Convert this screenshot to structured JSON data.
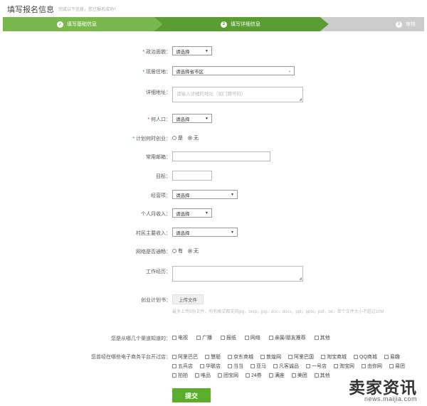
{
  "header": {
    "title": "填写报名信息",
    "subtitle": "完成以下信息，您已报名成功！"
  },
  "steps": [
    {
      "num": "✓",
      "label": "填写基础信息"
    },
    {
      "num": "2",
      "label": "填写详细信息"
    },
    {
      "num": "3",
      "label": "审核"
    }
  ],
  "colors": {
    "step_done": "#7ab84d",
    "step_active": "#5a9e33",
    "step_pending": "#cccccc",
    "submit": "#5dad2c"
  },
  "form": {
    "political": {
      "label": "政治面貌：",
      "value": "请选择"
    },
    "residence": {
      "label": "现居住地：",
      "value": "请选择省市区"
    },
    "address": {
      "label": "详细地址：",
      "placeholder": "请输入详细的地址（如门牌号码）"
    },
    "household": {
      "label": "何人口：",
      "value": "请选择"
    },
    "plan": {
      "label": "计划何时创业：",
      "opt1": "是",
      "opt2": "无"
    },
    "email": {
      "label": "常用邮箱："
    },
    "age": {
      "label": "目标："
    },
    "education": {
      "label": "经营项：",
      "value": "请选择"
    },
    "income": {
      "label": "个人月收入：",
      "value": "请选择"
    },
    "village_income": {
      "label": "村民主要收入：",
      "value": "请选择"
    },
    "online_shop": {
      "label": "网络是否通畅：",
      "opt1": "有",
      "opt2": "无"
    },
    "experience": {
      "label": "工作经历："
    },
    "plan_doc": {
      "label": "创业计划书：",
      "button": "上传文件",
      "hint": "最多上传5份文件，所有格式都支持jpg，bmp，jpg，doc，docx，ppt，pptx，pdf，txt，单个文件大小不超过10M"
    },
    "source": {
      "label": "您是从哪几个渠道知道的：",
      "options": [
        "电视",
        "广播",
        "报纸",
        "网络",
        "亲属/朋友推荐",
        "其他"
      ]
    },
    "platforms": {
      "label": "您曾经在哪些电子商务平台开过店：",
      "rows": [
        [
          "阿里巴巴",
          "慧聪",
          "京东商城",
          "敦煌网",
          "阿里巴国",
          "淘宝商城",
          "QQ商城",
          "易趣"
        ],
        [
          "五兵店",
          "华联店",
          "当当",
          "亚马",
          "凡客诚品",
          "一号店",
          "淘宝网",
          "由你网",
          "易团"
        ],
        [
          "拍拍",
          "唯品",
          "团宝网",
          "24券",
          "满座",
          "美团",
          "其他"
        ]
      ]
    },
    "submit": "提交"
  },
  "watermark": {
    "text": "卖家资讯",
    "url": "news.maijia.com"
  }
}
